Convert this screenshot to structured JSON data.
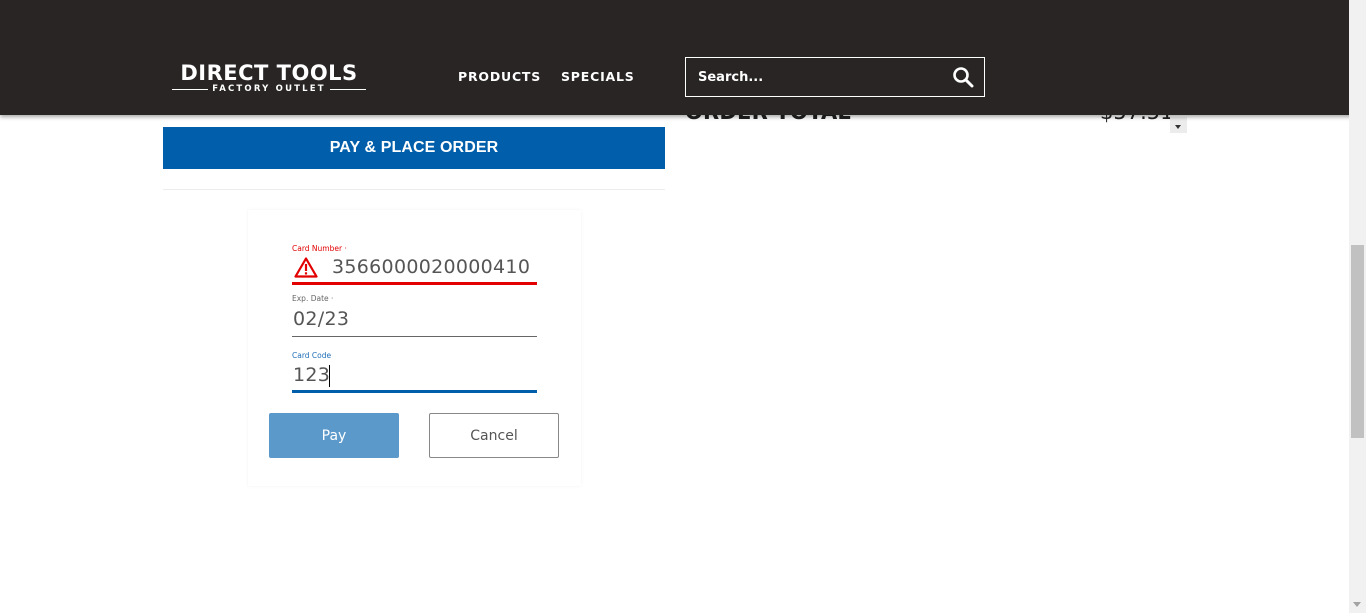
{
  "header": {
    "logo_main": "DIRECT TOOLS",
    "logo_sub": "FACTORY OUTLET",
    "nav": {
      "products": "PRODUCTS",
      "specials": "SPECIALS"
    },
    "search": {
      "placeholder": "Search..."
    },
    "colors": {
      "background": "#282524",
      "text": "#ffffff"
    }
  },
  "checkout": {
    "pay_place_order_label": "PAY & PLACE ORDER",
    "order_total_label": "ORDER TOTAL",
    "order_total_value": "$57.51",
    "accent_color": "#005eaa"
  },
  "payment_form": {
    "card_number": {
      "label": "Card Number ·",
      "value": "3566000020000410",
      "state": "error",
      "icon": "warning-icon"
    },
    "exp_date": {
      "label": "Exp. Date ·",
      "value": "02/23"
    },
    "card_code": {
      "label": "Card Code",
      "value": "123",
      "state": "focused"
    },
    "pay_label": "Pay",
    "cancel_label": "Cancel",
    "error_color": "#e20000"
  }
}
